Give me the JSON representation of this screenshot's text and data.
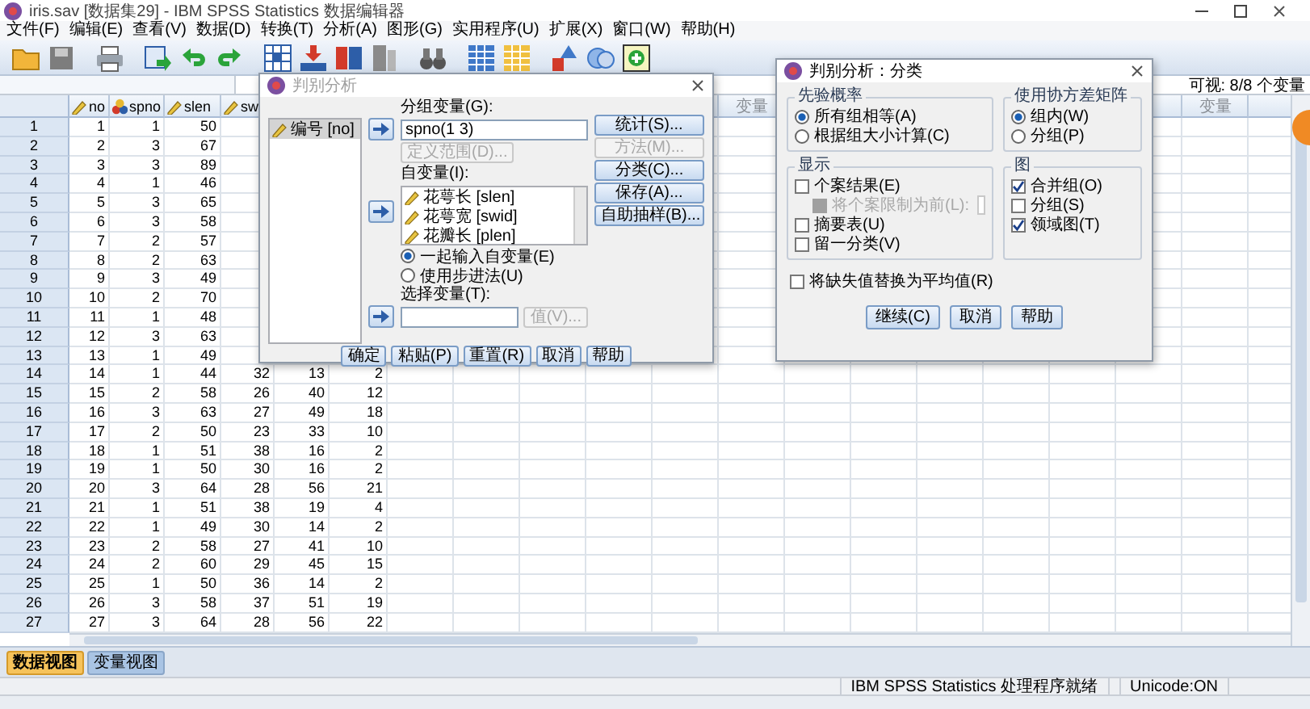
{
  "window": {
    "title": "iris.sav [数据集29] - IBM SPSS Statistics 数据编辑器"
  },
  "menu": [
    "文件(F)",
    "编辑(E)",
    "查看(V)",
    "数据(D)",
    "转换(T)",
    "分析(A)",
    "图形(G)",
    "实用程序(U)",
    "扩展(X)",
    "窗口(W)",
    "帮助(H)"
  ],
  "visible_variables": "可视: 8/8 个变量",
  "grid": {
    "columns": [
      {
        "header": "no",
        "kind": "scale"
      },
      {
        "header": "spno",
        "kind": "nominal"
      },
      {
        "header": "slen",
        "kind": "scale"
      },
      {
        "header": "sw",
        "kind": "scale"
      },
      {
        "kind": "scale"
      },
      {
        "kind": "scale"
      },
      {
        "kind": "placeholder"
      },
      {
        "kind": "placeholder"
      },
      {
        "kind": "placeholder"
      },
      {
        "kind": "placeholder"
      },
      {
        "kind": "placeholder"
      },
      {
        "header": "变量",
        "kind": "placeholder"
      },
      {
        "kind": "placeholder"
      },
      {
        "kind": "placeholder"
      },
      {
        "kind": "placeholder"
      },
      {
        "kind": "placeholder"
      },
      {
        "kind": "placeholder"
      },
      {
        "kind": "placeholder"
      },
      {
        "header": "变量",
        "kind": "placeholder"
      },
      {
        "kind": "placeholder"
      }
    ],
    "rows": [
      {
        "number": "1",
        "cells": [
          "1",
          "1",
          "50"
        ]
      },
      {
        "number": "2",
        "cells": [
          "2",
          "3",
          "67"
        ]
      },
      {
        "number": "3",
        "cells": [
          "3",
          "3",
          "89"
        ]
      },
      {
        "number": "4",
        "cells": [
          "4",
          "1",
          "46"
        ]
      },
      {
        "number": "5",
        "cells": [
          "5",
          "3",
          "65"
        ]
      },
      {
        "number": "6",
        "cells": [
          "6",
          "3",
          "58"
        ]
      },
      {
        "number": "7",
        "cells": [
          "7",
          "2",
          "57"
        ]
      },
      {
        "number": "8",
        "cells": [
          "8",
          "2",
          "63"
        ]
      },
      {
        "number": "9",
        "cells": [
          "9",
          "3",
          "49"
        ]
      },
      {
        "number": "10",
        "cells": [
          "10",
          "2",
          "70"
        ]
      },
      {
        "number": "11",
        "cells": [
          "11",
          "1",
          "48"
        ]
      },
      {
        "number": "12",
        "cells": [
          "12",
          "3",
          "63"
        ]
      },
      {
        "number": "13",
        "cells": [
          "13",
          "1",
          "49"
        ]
      },
      {
        "number": "14",
        "cells": [
          "14",
          "1",
          "44",
          "32",
          "13",
          "2"
        ]
      },
      {
        "number": "15",
        "cells": [
          "15",
          "2",
          "58",
          "26",
          "40",
          "12"
        ]
      },
      {
        "number": "16",
        "cells": [
          "16",
          "3",
          "63",
          "27",
          "49",
          "18"
        ]
      },
      {
        "number": "17",
        "cells": [
          "17",
          "2",
          "50",
          "23",
          "33",
          "10"
        ]
      },
      {
        "number": "18",
        "cells": [
          "18",
          "1",
          "51",
          "38",
          "16",
          "2"
        ]
      },
      {
        "number": "19",
        "cells": [
          "19",
          "1",
          "50",
          "30",
          "16",
          "2"
        ]
      },
      {
        "number": "20",
        "cells": [
          "20",
          "3",
          "64",
          "28",
          "56",
          "21"
        ]
      },
      {
        "number": "21",
        "cells": [
          "21",
          "1",
          "51",
          "38",
          "19",
          "4"
        ]
      },
      {
        "number": "22",
        "cells": [
          "22",
          "1",
          "49",
          "30",
          "14",
          "2"
        ]
      },
      {
        "number": "23",
        "cells": [
          "23",
          "2",
          "58",
          "27",
          "41",
          "10"
        ]
      },
      {
        "number": "24",
        "cells": [
          "24",
          "2",
          "60",
          "29",
          "45",
          "15"
        ]
      },
      {
        "number": "25",
        "cells": [
          "25",
          "1",
          "50",
          "36",
          "14",
          "2"
        ]
      },
      {
        "number": "26",
        "cells": [
          "26",
          "3",
          "58",
          "37",
          "51",
          "19"
        ]
      },
      {
        "number": "27",
        "cells": [
          "27",
          "3",
          "64",
          "28",
          "56",
          "22"
        ]
      }
    ]
  },
  "main_dialog": {
    "title": "判别分析",
    "active": false,
    "source_list": [
      {
        "label": "编号 [no]",
        "selected": true
      }
    ],
    "grouping_label": "分组变量(G):",
    "grouping_value": "spno(1 3)",
    "define_range": {
      "label": "定义范围(D)...",
      "disabled": true
    },
    "independents_label": "自变量(I):",
    "independents": [
      "花萼长 [slen]",
      "花萼宽 [swid]",
      "花瓣长 [plen]"
    ],
    "methods": [
      {
        "label": "一起输入自变量(E)",
        "selected": true
      },
      {
        "label": "使用步进法(U)",
        "selected": false
      }
    ],
    "selection_label": "选择变量(T):",
    "value_button": {
      "label": "值(V)...",
      "disabled": true
    },
    "side_buttons": [
      {
        "label": "统计(S)...",
        "disabled": false
      },
      {
        "label": "方法(M)...",
        "disabled": true
      },
      {
        "label": "分类(C)...",
        "disabled": false
      },
      {
        "label": "保存(A)...",
        "disabled": false
      },
      {
        "label": "自助抽样(B)...",
        "disabled": false
      }
    ],
    "buttons": [
      "确定",
      "粘贴(P)",
      "重置(R)",
      "取消",
      "帮助"
    ]
  },
  "classify_dialog": {
    "title": "判别分析：分类",
    "active": true,
    "groups": [
      {
        "title": "先验概率",
        "options": [
          {
            "kind": "radio",
            "label": "所有组相等(A)",
            "selected": true
          },
          {
            "kind": "radio",
            "label": "根据组大小计算(C)",
            "selected": false
          }
        ]
      },
      {
        "title": "使用协方差矩阵",
        "options": [
          {
            "kind": "radio",
            "label": "组内(W)",
            "selected": true
          },
          {
            "kind": "radio",
            "label": "分组(P)",
            "selected": false
          }
        ]
      },
      {
        "title": "显示",
        "options": [
          {
            "kind": "check",
            "label": "个案结果(E)",
            "checked": false
          },
          {
            "kind": "limit",
            "label": "将个案限制为前(L):",
            "checked": false,
            "disabled": true
          },
          {
            "kind": "check",
            "label": "摘要表(U)",
            "checked": false
          },
          {
            "kind": "check",
            "label": "留一分类(V)",
            "checked": false
          }
        ]
      },
      {
        "title": "图",
        "options": [
          {
            "kind": "check",
            "label": "合并组(O)",
            "checked": true
          },
          {
            "kind": "check",
            "label": "分组(S)",
            "checked": false
          },
          {
            "kind": "check",
            "label": "领域图(T)",
            "checked": true
          }
        ]
      }
    ],
    "replace_missing": {
      "label": "将缺失值替换为平均值(R)",
      "checked": false
    },
    "buttons": [
      "继续(C)",
      "取消",
      "帮助"
    ]
  },
  "view_tabs": [
    {
      "label": "数据视图",
      "selected": true
    },
    {
      "label": "变量视图",
      "selected": false
    }
  ],
  "status_bar": {
    "message": "IBM SPSS Statistics 处理程序就绪",
    "encoding": "Unicode:ON"
  }
}
